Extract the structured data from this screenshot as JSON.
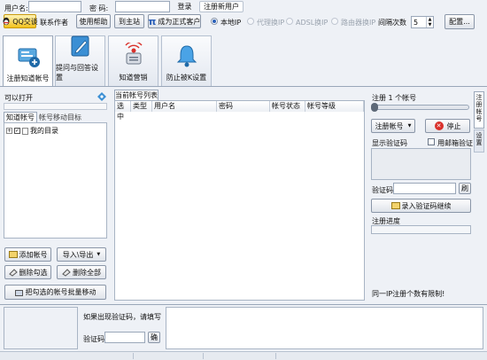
{
  "top": {
    "username_label": "用户名:",
    "username_value": "",
    "password_label": "密  码:",
    "password_value": "",
    "login_button": "登录",
    "register_link": "注册新用户",
    "qq_button": "QQ交谈",
    "contact_author": "联系作者",
    "help_button": "使用帮助",
    "home_button": "到主站",
    "formal_button": "成为正式客户",
    "radio_local": "本地IP",
    "radio_proxy": "代理换IP",
    "radio_adsl": "ADSL换IP",
    "radio_router": "路由器换IP",
    "interval_label": "间隔次数",
    "interval_value": "5",
    "config_button": "配置..."
  },
  "tabs": [
    {
      "label": "注册知道帐号",
      "icon": "register-account-icon"
    },
    {
      "label": "提问与回答设置",
      "icon": "edit-pen-icon"
    },
    {
      "label": "知道营销",
      "icon": "broadcast-icon"
    },
    {
      "label": "防止被K设置",
      "icon": "bell-icon"
    }
  ],
  "left": {
    "can_open_label": "可以打开",
    "subtabs": [
      "知道帐号",
      "帐号移动目标"
    ],
    "tree_root": "我的目录",
    "add_account": "添加帐号",
    "import_export": "导入\\导出",
    "delete_checked": "删除勾选",
    "delete_all": "删除全部",
    "batch_move": "把勾选的帐号批量移动"
  },
  "center": {
    "list_tab": "当前帐号列表",
    "columns": [
      "选中",
      "类型",
      "用户名",
      "密码",
      "帐号状态",
      "帐号等级"
    ]
  },
  "right": {
    "register_count": "注册 1 个帐号",
    "side_tabs": [
      "注册帐号",
      "设置"
    ],
    "register_button": "注册帐号",
    "stop_button": "停止",
    "show_captcha": "显示验证码",
    "use_email_verify": "用邮箱验证",
    "captcha_label": "验证码",
    "refresh_button": "刷",
    "enter_captcha_button": "录入验证码继续",
    "progress_label": "注册进度",
    "ip_limit_note": "同一IP注册个数有限制!"
  },
  "bottom": {
    "captcha_hint": "如果出现验证码，请填写",
    "captcha_label": "验证码",
    "captcha_value": "",
    "confirm_button": "确"
  },
  "colors": {
    "accent": "#2a5fb8",
    "stop_red": "#d9302a",
    "qq_yellow": "#f2c21b"
  }
}
